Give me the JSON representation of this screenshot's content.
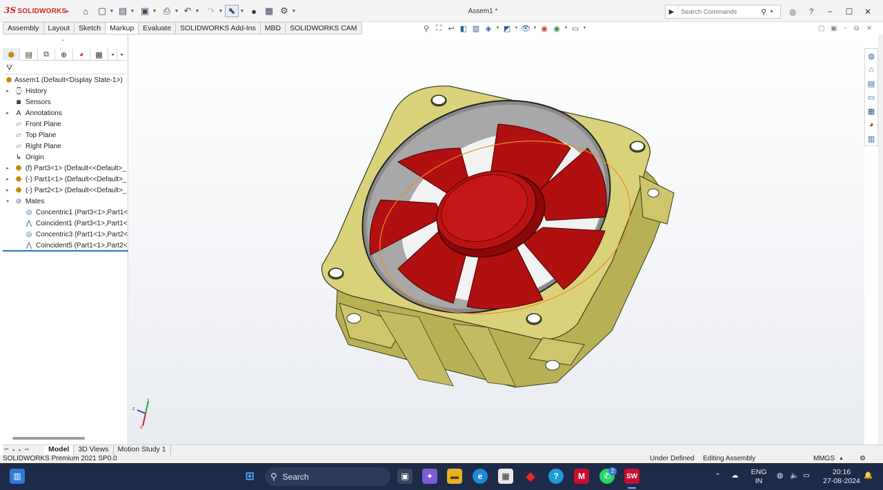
{
  "app": {
    "logo_text": "SOLIDWORKS",
    "document_title": "Assem1 *",
    "search_placeholder": "Search Commands"
  },
  "command_tabs": [
    "Assembly",
    "Layout",
    "Sketch",
    "Markup",
    "Evaluate",
    "SOLIDWORKS Add-Ins",
    "MBD",
    "SOLIDWORKS CAM"
  ],
  "feature_tree": {
    "root": "Assem1  (Default<Display State-1>)",
    "items": [
      {
        "label": "History",
        "icon": "history-icon"
      },
      {
        "label": "Sensors",
        "icon": "sensor-icon"
      },
      {
        "label": "Annotations",
        "icon": "annotation-icon"
      },
      {
        "label": "Front Plane",
        "icon": "plane-icon"
      },
      {
        "label": "Top Plane",
        "icon": "plane-icon"
      },
      {
        "label": "Right Plane",
        "icon": "plane-icon"
      },
      {
        "label": "Origin",
        "icon": "origin-icon"
      },
      {
        "label": "(f) Part3<1> (Default<<Default>_",
        "icon": "part-icon"
      },
      {
        "label": "(-) Part1<1> (Default<<Default>_",
        "icon": "part-icon"
      },
      {
        "label": "(-) Part2<1> (Default<<Default>_",
        "icon": "part-icon"
      },
      {
        "label": "Mates",
        "icon": "mates-icon"
      },
      {
        "label": "Concentric1 (Part3<1>,Part1<",
        "icon": "concentric-icon"
      },
      {
        "label": "Coincident1 (Part3<1>,Part1<",
        "icon": "coincident-icon"
      },
      {
        "label": "Concentric3 (Part1<1>,Part2<",
        "icon": "concentric-icon"
      },
      {
        "label": "Coincident5 (Part1<1>,Part2<",
        "icon": "coincident-icon"
      }
    ]
  },
  "bottom_tabs": [
    "Model",
    "3D Views",
    "Motion Study 1"
  ],
  "status": {
    "product": "SOLIDWORKS Premium 2021 SP0.0",
    "definition": "Under Defined",
    "mode": "Editing Assembly",
    "units": "MMGS"
  },
  "taskbar": {
    "search_label": "Search",
    "lang_line1": "ENG",
    "lang_line2": "IN",
    "time": "20:16",
    "date": "27-08-2024",
    "notification_count": "2"
  },
  "colors": {
    "fan_frame": "#d9d27a",
    "fan_blade": "#b01010",
    "selection_outline": "#f08a1e",
    "taskbar_bg": "#1d2a48"
  }
}
